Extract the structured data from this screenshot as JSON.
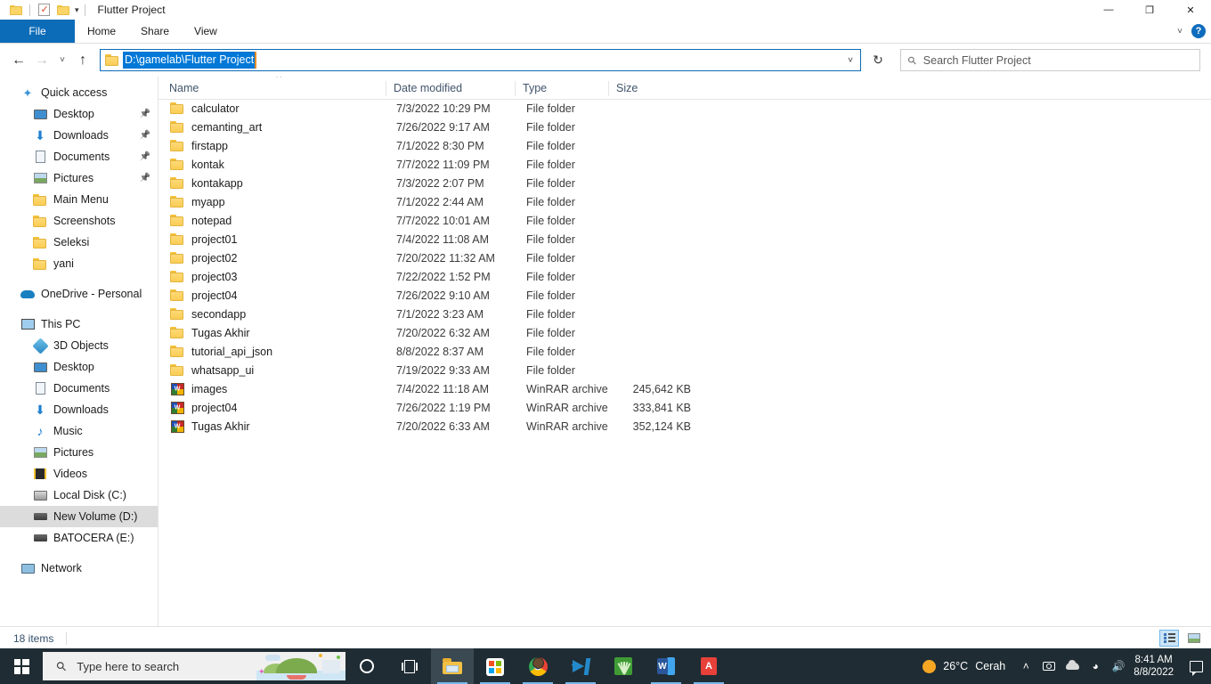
{
  "window": {
    "title": "Flutter Project",
    "quick_access_toolbar": [
      {
        "name": "properties-icon",
        "label": "Properties"
      },
      {
        "name": "new-folder-icon",
        "label": "New folder"
      },
      {
        "name": "customize-caret-icon",
        "label": "Customize Quick Access Toolbar"
      }
    ],
    "controls": {
      "minimize": "—",
      "maximize": "❐",
      "close": "✕"
    }
  },
  "ribbon": {
    "tabs": [
      {
        "label": "File",
        "active": true
      },
      {
        "label": "Home",
        "active": false
      },
      {
        "label": "Share",
        "active": false
      },
      {
        "label": "View",
        "active": false
      }
    ],
    "collapse_caret": "˅",
    "help_label": "?"
  },
  "navigation": {
    "back": "←",
    "forward": "→",
    "recent": "˅",
    "up": "↑",
    "refresh": "↻",
    "address": {
      "value": "D:\\gamelab\\Flutter Project",
      "dropdown_caret": "˅"
    },
    "search": {
      "placeholder": "Search Flutter Project",
      "value": ""
    }
  },
  "sidebar": {
    "items": [
      {
        "label": "Quick access",
        "icon": "star-icon",
        "level": 0,
        "pinned": false,
        "selected": false
      },
      {
        "label": "Desktop",
        "icon": "desktop-icon",
        "level": 1,
        "pinned": true,
        "selected": false
      },
      {
        "label": "Downloads",
        "icon": "download-icon",
        "level": 1,
        "pinned": true,
        "selected": false
      },
      {
        "label": "Documents",
        "icon": "document-icon",
        "level": 1,
        "pinned": true,
        "selected": false
      },
      {
        "label": "Pictures",
        "icon": "picture-icon",
        "level": 1,
        "pinned": true,
        "selected": false
      },
      {
        "label": "Main Menu",
        "icon": "folder-icon",
        "level": 1,
        "pinned": false,
        "selected": false
      },
      {
        "label": "Screenshots",
        "icon": "folder-icon",
        "level": 1,
        "pinned": false,
        "selected": false
      },
      {
        "label": "Seleksi",
        "icon": "folder-icon",
        "level": 1,
        "pinned": false,
        "selected": false
      },
      {
        "label": "yani",
        "icon": "folder-icon",
        "level": 1,
        "pinned": false,
        "selected": false
      },
      {
        "label": "OneDrive - Personal",
        "icon": "onedrive-icon",
        "level": 0,
        "pinned": false,
        "selected": false,
        "gap_before": true
      },
      {
        "label": "This PC",
        "icon": "this-pc-icon",
        "level": 0,
        "pinned": false,
        "selected": false,
        "gap_before": true
      },
      {
        "label": "3D Objects",
        "icon": "3d-objects-icon",
        "level": 1,
        "pinned": false,
        "selected": false
      },
      {
        "label": "Desktop",
        "icon": "desktop-icon",
        "level": 1,
        "pinned": false,
        "selected": false
      },
      {
        "label": "Documents",
        "icon": "document-icon",
        "level": 1,
        "pinned": false,
        "selected": false
      },
      {
        "label": "Downloads",
        "icon": "download-icon",
        "level": 1,
        "pinned": false,
        "selected": false
      },
      {
        "label": "Music",
        "icon": "music-icon",
        "level": 1,
        "pinned": false,
        "selected": false
      },
      {
        "label": "Pictures",
        "icon": "picture-icon",
        "level": 1,
        "pinned": false,
        "selected": false
      },
      {
        "label": "Videos",
        "icon": "video-icon",
        "level": 1,
        "pinned": false,
        "selected": false
      },
      {
        "label": "Local Disk (C:)",
        "icon": "disk-icon",
        "level": 1,
        "pinned": false,
        "selected": false
      },
      {
        "label": "New Volume (D:)",
        "icon": "drive-icon",
        "level": 1,
        "pinned": false,
        "selected": true
      },
      {
        "label": "BATOCERA (E:)",
        "icon": "drive-icon",
        "level": 1,
        "pinned": false,
        "selected": false
      },
      {
        "label": "Network",
        "icon": "network-icon",
        "level": 0,
        "pinned": false,
        "selected": false,
        "gap_before": true
      }
    ]
  },
  "filelist": {
    "columns": [
      {
        "label": "Name",
        "sorted": true,
        "sort_direction": "ascending"
      },
      {
        "label": "Date modified",
        "sorted": false
      },
      {
        "label": "Type",
        "sorted": false
      },
      {
        "label": "Size",
        "sorted": false
      }
    ],
    "sort_indicator": "˄",
    "rows": [
      {
        "name": "calculator",
        "date": "7/3/2022 10:29 PM",
        "type": "File folder",
        "size": "",
        "icon": "folder-icon"
      },
      {
        "name": "cemanting_art",
        "date": "7/26/2022 9:17 AM",
        "type": "File folder",
        "size": "",
        "icon": "folder-icon"
      },
      {
        "name": "firstapp",
        "date": "7/1/2022 8:30 PM",
        "type": "File folder",
        "size": "",
        "icon": "folder-icon"
      },
      {
        "name": "kontak",
        "date": "7/7/2022 11:09 PM",
        "type": "File folder",
        "size": "",
        "icon": "folder-icon"
      },
      {
        "name": "kontakapp",
        "date": "7/3/2022 2:07 PM",
        "type": "File folder",
        "size": "",
        "icon": "folder-icon"
      },
      {
        "name": "myapp",
        "date": "7/1/2022 2:44 AM",
        "type": "File folder",
        "size": "",
        "icon": "folder-icon"
      },
      {
        "name": "notepad",
        "date": "7/7/2022 10:01 AM",
        "type": "File folder",
        "size": "",
        "icon": "folder-icon"
      },
      {
        "name": "project01",
        "date": "7/4/2022 11:08 AM",
        "type": "File folder",
        "size": "",
        "icon": "folder-icon"
      },
      {
        "name": "project02",
        "date": "7/20/2022 11:32 AM",
        "type": "File folder",
        "size": "",
        "icon": "folder-icon"
      },
      {
        "name": "project03",
        "date": "7/22/2022 1:52 PM",
        "type": "File folder",
        "size": "",
        "icon": "folder-icon"
      },
      {
        "name": "project04",
        "date": "7/26/2022 9:10 AM",
        "type": "File folder",
        "size": "",
        "icon": "folder-icon"
      },
      {
        "name": "secondapp",
        "date": "7/1/2022 3:23 AM",
        "type": "File folder",
        "size": "",
        "icon": "folder-icon"
      },
      {
        "name": "Tugas Akhir",
        "date": "7/20/2022 6:32 AM",
        "type": "File folder",
        "size": "",
        "icon": "folder-icon"
      },
      {
        "name": "tutorial_api_json",
        "date": "8/8/2022 8:37 AM",
        "type": "File folder",
        "size": "",
        "icon": "folder-icon"
      },
      {
        "name": "whatsapp_ui",
        "date": "7/19/2022 9:33 AM",
        "type": "File folder",
        "size": "",
        "icon": "folder-icon"
      },
      {
        "name": "images",
        "date": "7/4/2022 11:18 AM",
        "type": "WinRAR archive",
        "size": "245,642 KB",
        "icon": "winrar-icon"
      },
      {
        "name": "project04",
        "date": "7/26/2022 1:19 PM",
        "type": "WinRAR archive",
        "size": "333,841 KB",
        "icon": "winrar-icon"
      },
      {
        "name": "Tugas Akhir",
        "date": "7/20/2022 6:33 AM",
        "type": "WinRAR archive",
        "size": "352,124 KB",
        "icon": "winrar-icon"
      }
    ]
  },
  "statusbar": {
    "item_count": "18 items",
    "views": [
      {
        "name": "details-view-button",
        "label": "Details",
        "active": true
      },
      {
        "name": "large-icons-view-button",
        "label": "Large icons",
        "active": false
      }
    ]
  },
  "taskbar": {
    "start_label": "Start",
    "search_placeholder": "Type here to search",
    "buttons": [
      {
        "name": "cortana-button",
        "label": "Cortana"
      },
      {
        "name": "task-view-button",
        "label": "Task View"
      },
      {
        "name": "file-explorer-button",
        "label": "File Explorer",
        "active": true
      },
      {
        "name": "microsoft-store-button",
        "label": "Microsoft Store",
        "open": true
      },
      {
        "name": "chrome-button",
        "label": "Google Chrome",
        "open": true
      },
      {
        "name": "vscode-button",
        "label": "Visual Studio Code",
        "open": true
      },
      {
        "name": "green-app-button",
        "label": "Green App",
        "open": false
      },
      {
        "name": "word-button",
        "label": "Microsoft Word",
        "open": true
      },
      {
        "name": "acrobat-button",
        "label": "Adobe Acrobat",
        "open": true
      }
    ],
    "tray": {
      "weather_temp": "26°C",
      "weather_desc": "Cerah",
      "show_hidden_caret": "˄",
      "icons": [
        {
          "name": "camera-icon",
          "label": "Camera"
        },
        {
          "name": "onedrive-cloud-icon",
          "label": "OneDrive"
        },
        {
          "name": "wifi-icon",
          "label": "Network"
        },
        {
          "name": "volume-icon",
          "label": "Volume"
        }
      ],
      "time": "8:41 AM",
      "date": "8/8/2022",
      "action_center_label": "Notifications"
    }
  },
  "colors": {
    "accent": "#0d6cb8",
    "selection": "#0078d7",
    "taskbar_bg": "#1f2c33",
    "folder_yellow": "#fbcd55"
  }
}
